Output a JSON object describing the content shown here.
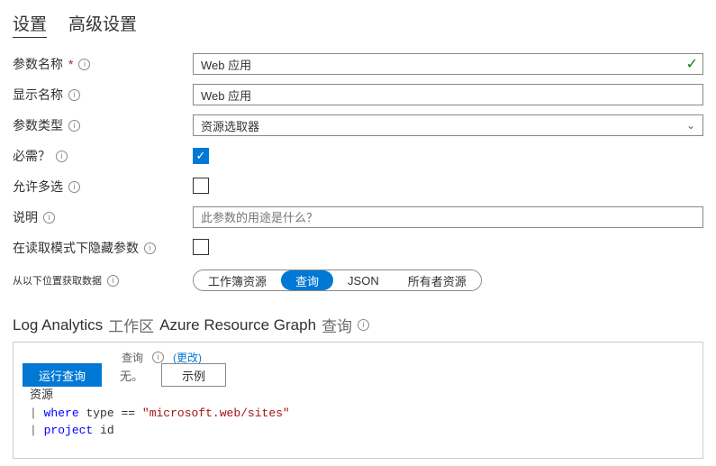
{
  "tabs": {
    "settings": "设置",
    "advanced": "高级设置"
  },
  "labels": {
    "param_name": "参数名称",
    "display_name": "显示名称",
    "param_type": "参数类型",
    "required": "必需？",
    "allow_multi": "允许多选",
    "description": "说明",
    "hide_in_read": "在读取模式下隐藏参数",
    "get_data_from": "从以下位置获取数据"
  },
  "values": {
    "param_name": "Web 应用",
    "display_name": "Web 应用",
    "param_type": "资源选取器",
    "description_placeholder": "此参数的用途是什么？"
  },
  "pills": {
    "workbook": "工作簿资源",
    "query": "查询",
    "json": "JSON",
    "owner": "所有者资源"
  },
  "section": {
    "prefix": "Log Analytics",
    "mid1": "工作区",
    "mid2": "Azure Resource Graph",
    "suffix": "查询"
  },
  "toolbar": {
    "query_label": "查询",
    "change": "(更改)",
    "run": "运行查询",
    "none": "无。",
    "example": "示例"
  },
  "code": {
    "line1": "资源",
    "kw_where": "where",
    "field_type": "type",
    "op": "==",
    "str_val": "\"microsoft.web/sites\"",
    "kw_project": "project",
    "field_id": "id"
  }
}
